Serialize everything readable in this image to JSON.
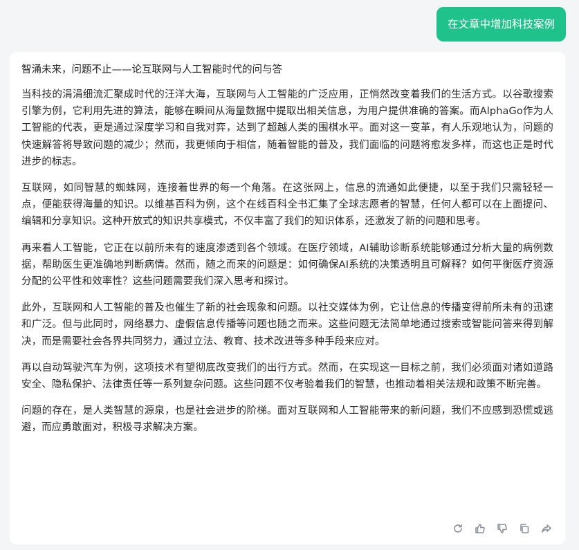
{
  "user_message": {
    "text": "在文章中增加科技案例"
  },
  "answer": {
    "title": "智涌未来，问题不止——论互联网与人工智能时代的问与答",
    "paragraphs": [
      "当科技的涓涓细流汇聚成时代的汪洋大海，互联网与人工智能的广泛应用，正悄然改变着我们的生活方式。以谷歌搜索引擎为例，它利用先进的算法，能够在瞬间从海量数据中提取出相关信息，为用户提供准确的答案。而AlphaGo作为人工智能的代表，更是通过深度学习和自我对弈，达到了超越人类的围棋水平。面对这一变革，有人乐观地认为，问题的快速解答将导致问题的减少；然而，我更倾向于相信，随着智能的普及，我们面临的问题将愈发多样，而这也正是时代进步的标志。",
      "互联网，如同智慧的蜘蛛网，连接着世界的每一个角落。在这张网上，信息的流通如此便捷，以至于我们只需轻轻一点，便能获得海量的知识。以维基百科为例，这个在线百科全书汇集了全球志愿者的智慧，任何人都可以在上面提问、编辑和分享知识。这种开放式的知识共享模式，不仅丰富了我们的知识体系，还激发了新的问题和思考。",
      "再来看人工智能，它正在以前所未有的速度渗透到各个领域。在医疗领域，AI辅助诊断系统能够通过分析大量的病例数据，帮助医生更准确地判断病情。然而，随之而来的问题是：如何确保AI系统的决策透明且可解释？如何平衡医疗资源分配的公平性和效率性？这些问题需要我们深入思考和探讨。",
      "此外，互联网和人工智能的普及也催生了新的社会现象和问题。以社交媒体为例，它让信息的传播变得前所未有的迅速和广泛。但与此同时，网络暴力、虚假信息传播等问题也随之而来。这些问题无法简单地通过搜索或智能问答来得到解决，而是需要社会各界共同努力，通过立法、教育、技术改进等多种手段来应对。",
      "再以自动驾驶汽车为例，这项技术有望彻底改变我们的出行方式。然而，在实现这一目标之前，我们必须面对诸如道路安全、隐私保护、法律责任等一系列复杂问题。这些问题不仅考验着我们的智慧，也推动着相关法规和政策不断完善。",
      "问题的存在，是人类智慧的源泉，也是社会进步的阶梯。面对互联网和人工智能带来的新问题，我们不应感到恐慌或逃避，而应勇敢面对，积极寻求解决方案。"
    ]
  },
  "actions": [
    {
      "icon": "refresh-icon"
    },
    {
      "icon": "thumbs-up-icon"
    },
    {
      "icon": "thumbs-down-icon"
    },
    {
      "icon": "copy-icon"
    },
    {
      "icon": "share-icon"
    }
  ],
  "colors": {
    "accent": "#1fc28a",
    "page_background": "#f4f5f7",
    "card_background": "#ffffff",
    "icon_gray": "#8a8f99"
  }
}
